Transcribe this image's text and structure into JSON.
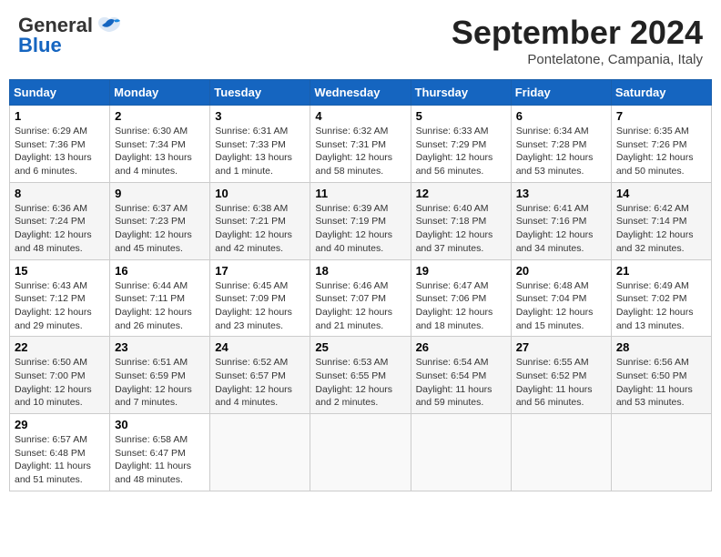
{
  "header": {
    "logo_general": "General",
    "logo_blue": "Blue",
    "month_title": "September 2024",
    "location": "Pontelatone, Campania, Italy"
  },
  "weekdays": [
    "Sunday",
    "Monday",
    "Tuesday",
    "Wednesday",
    "Thursday",
    "Friday",
    "Saturday"
  ],
  "weeks": [
    [
      {
        "day": "1",
        "info": "Sunrise: 6:29 AM\nSunset: 7:36 PM\nDaylight: 13 hours\nand 6 minutes."
      },
      {
        "day": "2",
        "info": "Sunrise: 6:30 AM\nSunset: 7:34 PM\nDaylight: 13 hours\nand 4 minutes."
      },
      {
        "day": "3",
        "info": "Sunrise: 6:31 AM\nSunset: 7:33 PM\nDaylight: 13 hours\nand 1 minute."
      },
      {
        "day": "4",
        "info": "Sunrise: 6:32 AM\nSunset: 7:31 PM\nDaylight: 12 hours\nand 58 minutes."
      },
      {
        "day": "5",
        "info": "Sunrise: 6:33 AM\nSunset: 7:29 PM\nDaylight: 12 hours\nand 56 minutes."
      },
      {
        "day": "6",
        "info": "Sunrise: 6:34 AM\nSunset: 7:28 PM\nDaylight: 12 hours\nand 53 minutes."
      },
      {
        "day": "7",
        "info": "Sunrise: 6:35 AM\nSunset: 7:26 PM\nDaylight: 12 hours\nand 50 minutes."
      }
    ],
    [
      {
        "day": "8",
        "info": "Sunrise: 6:36 AM\nSunset: 7:24 PM\nDaylight: 12 hours\nand 48 minutes."
      },
      {
        "day": "9",
        "info": "Sunrise: 6:37 AM\nSunset: 7:23 PM\nDaylight: 12 hours\nand 45 minutes."
      },
      {
        "day": "10",
        "info": "Sunrise: 6:38 AM\nSunset: 7:21 PM\nDaylight: 12 hours\nand 42 minutes."
      },
      {
        "day": "11",
        "info": "Sunrise: 6:39 AM\nSunset: 7:19 PM\nDaylight: 12 hours\nand 40 minutes."
      },
      {
        "day": "12",
        "info": "Sunrise: 6:40 AM\nSunset: 7:18 PM\nDaylight: 12 hours\nand 37 minutes."
      },
      {
        "day": "13",
        "info": "Sunrise: 6:41 AM\nSunset: 7:16 PM\nDaylight: 12 hours\nand 34 minutes."
      },
      {
        "day": "14",
        "info": "Sunrise: 6:42 AM\nSunset: 7:14 PM\nDaylight: 12 hours\nand 32 minutes."
      }
    ],
    [
      {
        "day": "15",
        "info": "Sunrise: 6:43 AM\nSunset: 7:12 PM\nDaylight: 12 hours\nand 29 minutes."
      },
      {
        "day": "16",
        "info": "Sunrise: 6:44 AM\nSunset: 7:11 PM\nDaylight: 12 hours\nand 26 minutes."
      },
      {
        "day": "17",
        "info": "Sunrise: 6:45 AM\nSunset: 7:09 PM\nDaylight: 12 hours\nand 23 minutes."
      },
      {
        "day": "18",
        "info": "Sunrise: 6:46 AM\nSunset: 7:07 PM\nDaylight: 12 hours\nand 21 minutes."
      },
      {
        "day": "19",
        "info": "Sunrise: 6:47 AM\nSunset: 7:06 PM\nDaylight: 12 hours\nand 18 minutes."
      },
      {
        "day": "20",
        "info": "Sunrise: 6:48 AM\nSunset: 7:04 PM\nDaylight: 12 hours\nand 15 minutes."
      },
      {
        "day": "21",
        "info": "Sunrise: 6:49 AM\nSunset: 7:02 PM\nDaylight: 12 hours\nand 13 minutes."
      }
    ],
    [
      {
        "day": "22",
        "info": "Sunrise: 6:50 AM\nSunset: 7:00 PM\nDaylight: 12 hours\nand 10 minutes."
      },
      {
        "day": "23",
        "info": "Sunrise: 6:51 AM\nSunset: 6:59 PM\nDaylight: 12 hours\nand 7 minutes."
      },
      {
        "day": "24",
        "info": "Sunrise: 6:52 AM\nSunset: 6:57 PM\nDaylight: 12 hours\nand 4 minutes."
      },
      {
        "day": "25",
        "info": "Sunrise: 6:53 AM\nSunset: 6:55 PM\nDaylight: 12 hours\nand 2 minutes."
      },
      {
        "day": "26",
        "info": "Sunrise: 6:54 AM\nSunset: 6:54 PM\nDaylight: 11 hours\nand 59 minutes."
      },
      {
        "day": "27",
        "info": "Sunrise: 6:55 AM\nSunset: 6:52 PM\nDaylight: 11 hours\nand 56 minutes."
      },
      {
        "day": "28",
        "info": "Sunrise: 6:56 AM\nSunset: 6:50 PM\nDaylight: 11 hours\nand 53 minutes."
      }
    ],
    [
      {
        "day": "29",
        "info": "Sunrise: 6:57 AM\nSunset: 6:48 PM\nDaylight: 11 hours\nand 51 minutes."
      },
      {
        "day": "30",
        "info": "Sunrise: 6:58 AM\nSunset: 6:47 PM\nDaylight: 11 hours\nand 48 minutes."
      },
      {
        "day": "",
        "info": ""
      },
      {
        "day": "",
        "info": ""
      },
      {
        "day": "",
        "info": ""
      },
      {
        "day": "",
        "info": ""
      },
      {
        "day": "",
        "info": ""
      }
    ]
  ]
}
